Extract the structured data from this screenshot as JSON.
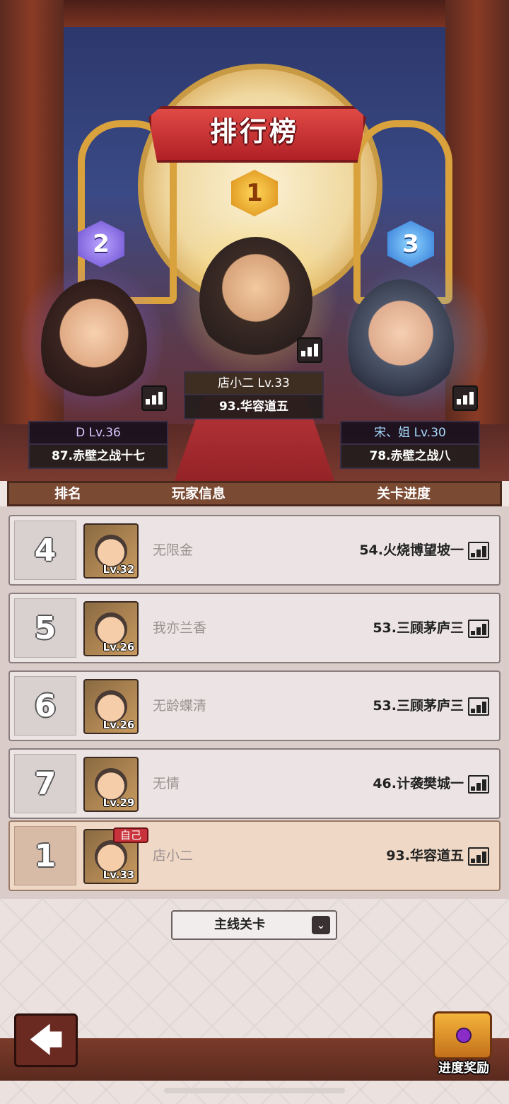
{
  "title": "排行榜",
  "podium": [
    {
      "rank": "1",
      "name": "店小二 Lv.33",
      "stage": "93.华容道五"
    },
    {
      "rank": "2",
      "name": "D Lv.36",
      "stage": "87.赤壁之战十七"
    },
    {
      "rank": "3",
      "name": "宋、姐 Lv.30",
      "stage": "78.赤壁之战八"
    }
  ],
  "table_header": {
    "rank": "排名",
    "player": "玩家信息",
    "progress": "关卡进度"
  },
  "rows": [
    {
      "rank": "4",
      "level": "Lv.32",
      "name": "无限金",
      "progress": "54.火烧博望坡一"
    },
    {
      "rank": "5",
      "level": "Lv.26",
      "name": "我亦兰香",
      "progress": "53.三顾茅庐三"
    },
    {
      "rank": "6",
      "level": "Lv.26",
      "name": "无龄蝶清",
      "progress": "53.三顾茅庐三"
    },
    {
      "rank": "7",
      "level": "Lv.29",
      "name": "无情",
      "progress": "46.计袭樊城一"
    }
  ],
  "self_row": {
    "tag": "自己",
    "rank": "1",
    "level": "Lv.33",
    "name": "店小二",
    "progress": "93.华容道五"
  },
  "dropdown": {
    "label": "主线关卡",
    "icon": "chevron-down-icon"
  },
  "footer": {
    "back_icon": "arrow-left-icon",
    "back_glyph": "🡄",
    "reward_label": "进度奖励",
    "reward_icon": "treasure-chest-icon"
  },
  "colors": {
    "banner_red": "#c8323a",
    "self_row_bg": "#f0d8c6",
    "header_brown": "#7a4a33"
  }
}
